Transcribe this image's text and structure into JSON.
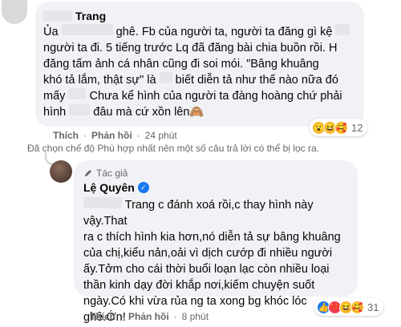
{
  "comment1": {
    "author_suffix": "Trang",
    "lines": [
      [
        "Ủa",
        "ghê. Fb của người ta, người ta đăng gì kệ"
      ],
      [
        "người ta đi. 5 tiếng trước Lq đã đăng bài chia buồn rồi. H"
      ],
      [
        "đăng tấm ảnh cá nhân cũng đi soi mói. \"Bâng khuâng"
      ],
      [
        "khó tả lắm, thật sự\" là",
        "biết diễn tả như thế nào nữa đó"
      ],
      [
        "mấy",
        "Chưa kể hình của người ta đàng hoàng chứ phải"
      ],
      [
        "hình",
        "đâu mà cứ xồn lên🙈"
      ]
    ],
    "like_label": "Thích",
    "reply_label": "Phản hồi",
    "time": "24 phút",
    "reaction_count": "12",
    "reactions": [
      "😮",
      "😆",
      "🥰"
    ]
  },
  "filter_note": "Đã chọn chế độ Phù hợp nhất nên một số câu trả lời có thể bị lọc ra.",
  "comment2": {
    "role": "Tác giả",
    "author": "Lệ Quyên",
    "lines": [
      [
        "Trang c đánh xoá rồi,c thay hình này vậy.That"
      ],
      [
        "ra c thích hình kia hơn,nó diễn tả sự bâng khuâng"
      ],
      [
        "của chị,kiểu nản,oải vì dịch cướp đi nhiều người"
      ],
      [
        "ấy.Tởm cho cái thời buổi loạn lạc còn nhiều loại"
      ],
      [
        "thần kinh dạy đời khắp nơi,kiếm chuyện suốt"
      ],
      [
        "ngày.Có khi vừa rủa ng ta xong bg khóc lóc"
      ],
      [
        "ghê.Ớn!"
      ]
    ],
    "like_label": "Thích",
    "reply_label": "Phản hồi",
    "time": "8 phút",
    "reaction_count": "31",
    "reactions": [
      "👍",
      "❤️",
      "😆",
      "🥰"
    ]
  }
}
